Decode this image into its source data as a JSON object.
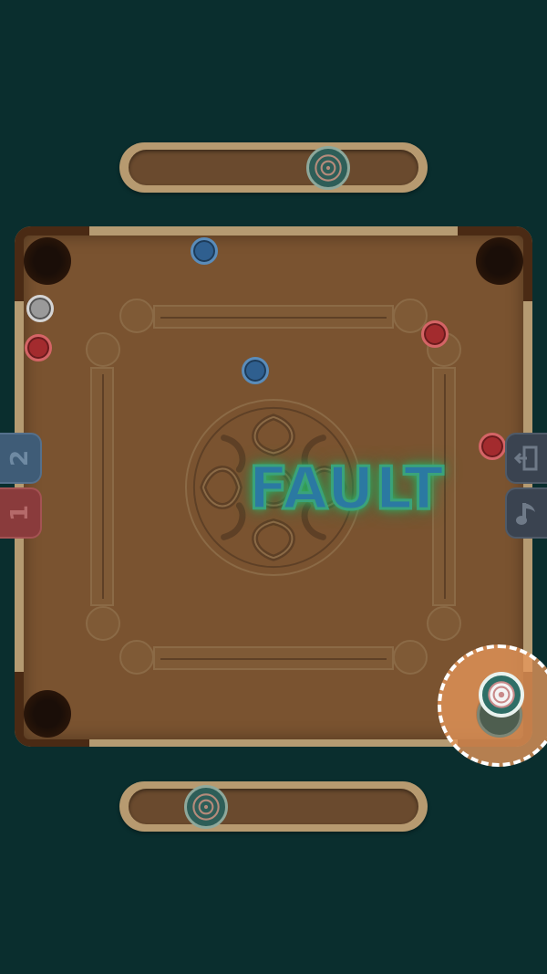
{
  "game": {
    "status_text": "FAULT",
    "left_tabs": [
      {
        "label": "2",
        "color": "#3f5c77"
      },
      {
        "label": "1",
        "color": "#8a3b3c"
      }
    ],
    "right_tabs": [
      {
        "icon": "exit-door-icon"
      },
      {
        "icon": "music-note-icon"
      }
    ]
  },
  "colors": {
    "background": "#0a2e2e",
    "board": "#7a5330",
    "frame": "#b59b72",
    "coin_blue": "#2f5f8f",
    "coin_red": "#a32b2e",
    "coin_white": "#9a9a9a",
    "fault_fill": "#2b79a2",
    "fault_glow": "#2fbf6a",
    "placement_circle": "#e6965a"
  },
  "icons": {
    "top_rail_striker": "striker-icon",
    "bottom_rail_striker": "striker-icon",
    "active_striker": "striker-icon",
    "center_design": "mandala-icon"
  }
}
